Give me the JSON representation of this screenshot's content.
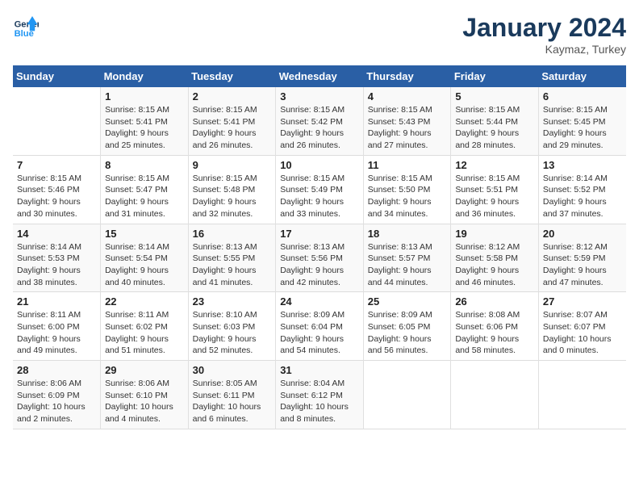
{
  "header": {
    "logo_line1": "General",
    "logo_line2": "Blue",
    "month": "January 2024",
    "location": "Kaymaz, Turkey"
  },
  "weekdays": [
    "Sunday",
    "Monday",
    "Tuesday",
    "Wednesday",
    "Thursday",
    "Friday",
    "Saturday"
  ],
  "weeks": [
    [
      {
        "num": "",
        "info": ""
      },
      {
        "num": "1",
        "info": "Sunrise: 8:15 AM\nSunset: 5:41 PM\nDaylight: 9 hours\nand 25 minutes."
      },
      {
        "num": "2",
        "info": "Sunrise: 8:15 AM\nSunset: 5:41 PM\nDaylight: 9 hours\nand 26 minutes."
      },
      {
        "num": "3",
        "info": "Sunrise: 8:15 AM\nSunset: 5:42 PM\nDaylight: 9 hours\nand 26 minutes."
      },
      {
        "num": "4",
        "info": "Sunrise: 8:15 AM\nSunset: 5:43 PM\nDaylight: 9 hours\nand 27 minutes."
      },
      {
        "num": "5",
        "info": "Sunrise: 8:15 AM\nSunset: 5:44 PM\nDaylight: 9 hours\nand 28 minutes."
      },
      {
        "num": "6",
        "info": "Sunrise: 8:15 AM\nSunset: 5:45 PM\nDaylight: 9 hours\nand 29 minutes."
      }
    ],
    [
      {
        "num": "7",
        "info": "Sunrise: 8:15 AM\nSunset: 5:46 PM\nDaylight: 9 hours\nand 30 minutes."
      },
      {
        "num": "8",
        "info": "Sunrise: 8:15 AM\nSunset: 5:47 PM\nDaylight: 9 hours\nand 31 minutes."
      },
      {
        "num": "9",
        "info": "Sunrise: 8:15 AM\nSunset: 5:48 PM\nDaylight: 9 hours\nand 32 minutes."
      },
      {
        "num": "10",
        "info": "Sunrise: 8:15 AM\nSunset: 5:49 PM\nDaylight: 9 hours\nand 33 minutes."
      },
      {
        "num": "11",
        "info": "Sunrise: 8:15 AM\nSunset: 5:50 PM\nDaylight: 9 hours\nand 34 minutes."
      },
      {
        "num": "12",
        "info": "Sunrise: 8:15 AM\nSunset: 5:51 PM\nDaylight: 9 hours\nand 36 minutes."
      },
      {
        "num": "13",
        "info": "Sunrise: 8:14 AM\nSunset: 5:52 PM\nDaylight: 9 hours\nand 37 minutes."
      }
    ],
    [
      {
        "num": "14",
        "info": "Sunrise: 8:14 AM\nSunset: 5:53 PM\nDaylight: 9 hours\nand 38 minutes."
      },
      {
        "num": "15",
        "info": "Sunrise: 8:14 AM\nSunset: 5:54 PM\nDaylight: 9 hours\nand 40 minutes."
      },
      {
        "num": "16",
        "info": "Sunrise: 8:13 AM\nSunset: 5:55 PM\nDaylight: 9 hours\nand 41 minutes."
      },
      {
        "num": "17",
        "info": "Sunrise: 8:13 AM\nSunset: 5:56 PM\nDaylight: 9 hours\nand 42 minutes."
      },
      {
        "num": "18",
        "info": "Sunrise: 8:13 AM\nSunset: 5:57 PM\nDaylight: 9 hours\nand 44 minutes."
      },
      {
        "num": "19",
        "info": "Sunrise: 8:12 AM\nSunset: 5:58 PM\nDaylight: 9 hours\nand 46 minutes."
      },
      {
        "num": "20",
        "info": "Sunrise: 8:12 AM\nSunset: 5:59 PM\nDaylight: 9 hours\nand 47 minutes."
      }
    ],
    [
      {
        "num": "21",
        "info": "Sunrise: 8:11 AM\nSunset: 6:00 PM\nDaylight: 9 hours\nand 49 minutes."
      },
      {
        "num": "22",
        "info": "Sunrise: 8:11 AM\nSunset: 6:02 PM\nDaylight: 9 hours\nand 51 minutes."
      },
      {
        "num": "23",
        "info": "Sunrise: 8:10 AM\nSunset: 6:03 PM\nDaylight: 9 hours\nand 52 minutes."
      },
      {
        "num": "24",
        "info": "Sunrise: 8:09 AM\nSunset: 6:04 PM\nDaylight: 9 hours\nand 54 minutes."
      },
      {
        "num": "25",
        "info": "Sunrise: 8:09 AM\nSunset: 6:05 PM\nDaylight: 9 hours\nand 56 minutes."
      },
      {
        "num": "26",
        "info": "Sunrise: 8:08 AM\nSunset: 6:06 PM\nDaylight: 9 hours\nand 58 minutes."
      },
      {
        "num": "27",
        "info": "Sunrise: 8:07 AM\nSunset: 6:07 PM\nDaylight: 10 hours\nand 0 minutes."
      }
    ],
    [
      {
        "num": "28",
        "info": "Sunrise: 8:06 AM\nSunset: 6:09 PM\nDaylight: 10 hours\nand 2 minutes."
      },
      {
        "num": "29",
        "info": "Sunrise: 8:06 AM\nSunset: 6:10 PM\nDaylight: 10 hours\nand 4 minutes."
      },
      {
        "num": "30",
        "info": "Sunrise: 8:05 AM\nSunset: 6:11 PM\nDaylight: 10 hours\nand 6 minutes."
      },
      {
        "num": "31",
        "info": "Sunrise: 8:04 AM\nSunset: 6:12 PM\nDaylight: 10 hours\nand 8 minutes."
      },
      {
        "num": "",
        "info": ""
      },
      {
        "num": "",
        "info": ""
      },
      {
        "num": "",
        "info": ""
      }
    ]
  ]
}
